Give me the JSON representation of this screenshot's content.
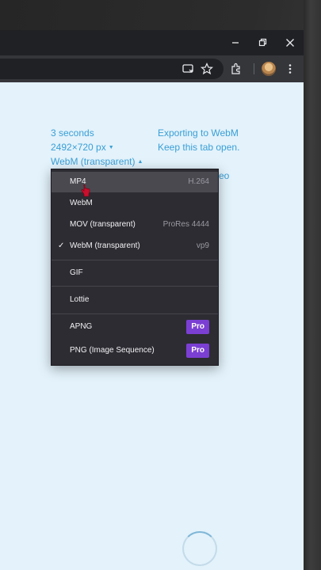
{
  "window_controls": {
    "minimize_icon": "minimize-icon",
    "restore_icon": "restore-icon",
    "close_icon": "close-icon"
  },
  "toolbar": {
    "icons": [
      "install-app-icon",
      "star-icon",
      "extensions-icon",
      "profile-avatar",
      "kebab-menu-icon"
    ]
  },
  "export_settings": {
    "duration": "3 seconds",
    "dimensions": "2492×720 px",
    "format": "WebM (transparent)"
  },
  "export_status": {
    "line1": "Exporting to WebM",
    "line2": "Keep this tab open.",
    "line3_partial": "eo"
  },
  "format_menu": {
    "items": [
      {
        "label": "MP4",
        "meta": "H.264",
        "hovered": true
      },
      {
        "label": "WebM",
        "meta": ""
      },
      {
        "label": "MOV (transparent)",
        "meta": "ProRes 4444"
      },
      {
        "label": "WebM (transparent)",
        "meta": "vp9",
        "checked": true
      },
      {
        "label": "GIF",
        "meta": ""
      },
      {
        "label": "Lottie",
        "meta": ""
      },
      {
        "label": "APNG",
        "badge": "Pro"
      },
      {
        "label": "PNG (Image Sequence)",
        "badge": "Pro"
      }
    ]
  },
  "colors": {
    "accent_text": "#3a9fd6",
    "pro_badge": "#7b3fd3",
    "menu_bg": "#2d2c32",
    "page_bg": "#e3f2fb"
  }
}
